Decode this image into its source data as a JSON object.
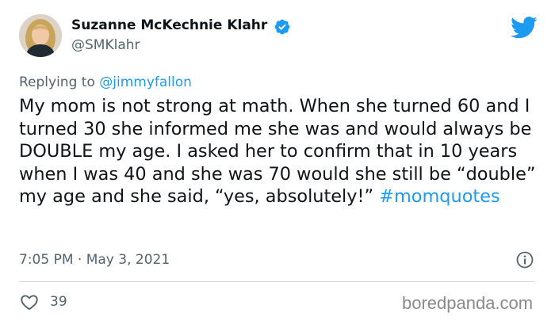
{
  "author": {
    "name": "Suzanne McKechnie Klahr",
    "handle": "@SMKlahr",
    "verified": true
  },
  "reply": {
    "prefix": "Replying to ",
    "mention": "@jimmyfallon"
  },
  "tweet": {
    "text": "My mom is not strong at math. When she turned 60 and I turned 30 she informed me she was and would always be DOUBLE my age.  I asked her to confirm that in 10 years when I was 40 and she was 70 would she still be “double” my age and she said, “yes, absolutely!”",
    "hashtag": "#momquotes"
  },
  "meta": {
    "timestamp": "7:05 PM · May 3, 2021"
  },
  "engagement": {
    "likes": "39"
  },
  "watermark": "boredpanda.com",
  "colors": {
    "link_blue": "#1d9bf0",
    "secondary_text": "#536471",
    "primary_text": "#0f1419"
  },
  "icons": {
    "verified": "verified-badge-icon",
    "brand": "twitter-bird-icon",
    "info": "info-icon",
    "like": "heart-icon"
  }
}
